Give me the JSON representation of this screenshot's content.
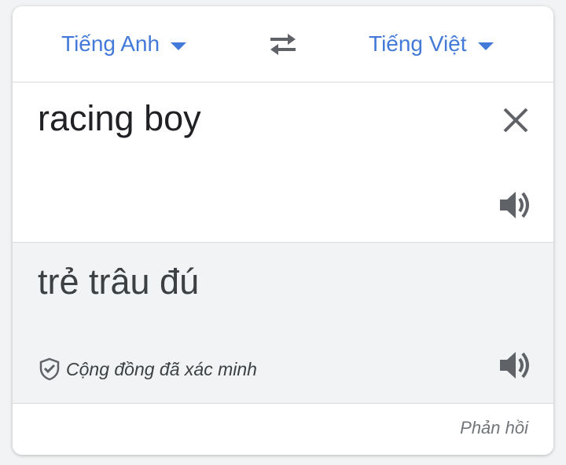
{
  "languages": {
    "source": "Tiếng Anh",
    "target": "Tiếng Việt"
  },
  "input": {
    "text": "racing boy"
  },
  "output": {
    "text": "trẻ trâu đú",
    "verified_label": "Cộng đồng đã xác minh"
  },
  "footer": {
    "feedback_label": "Phản hồi"
  },
  "icons": {
    "swap": "swap-icon",
    "clear": "close-icon",
    "speaker": "speaker-icon",
    "verified": "shield-check-icon"
  },
  "colors": {
    "accent": "#4379d8",
    "icon": "#5f6368",
    "output_bg": "#f1f3f4"
  }
}
